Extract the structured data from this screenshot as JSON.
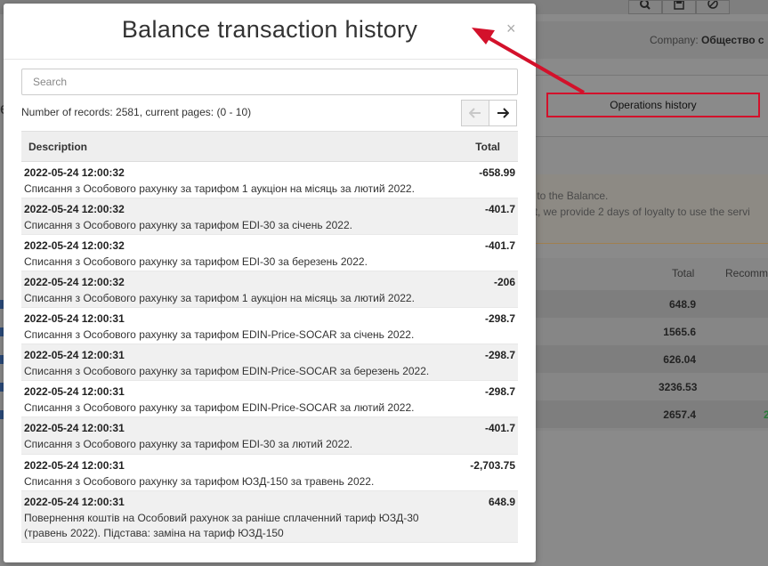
{
  "background": {
    "company_label": "Company:",
    "company_name": "Общество с",
    "operations_button": "Operations history",
    "notice_line1": "s to the Balance.",
    "notice_line2": "nt, we provide 2 days of loyalty to use the servi",
    "left_letter": "e",
    "table_header_total": "Total",
    "table_header_recommend": "Recomm",
    "table_values": [
      "648.9",
      "1565.6",
      "626.04",
      "3236.53",
      "2657.4"
    ],
    "trailing_digit": "2",
    "icons": [
      "search-icon",
      "save-icon",
      "block-icon"
    ]
  },
  "modal": {
    "title": "Balance transaction history",
    "close_label": "×",
    "search_placeholder": "Search",
    "records_text": "Number of records: 2581, current pages: (0 - 10)",
    "prev_label": "🡐",
    "next_label": "🡒",
    "columns": {
      "description": "Description",
      "total": "Total"
    },
    "rows": [
      {
        "date": "2022-05-24 12:00:32",
        "description": "Списання з Особового рахунку за тарифом 1 аукціон на місяць за лютий 2022.",
        "total": "-658.99"
      },
      {
        "date": "2022-05-24 12:00:32",
        "description": "Списання з Особового рахунку за тарифом EDI-30 за січень 2022.",
        "total": "-401.7"
      },
      {
        "date": "2022-05-24 12:00:32",
        "description": "Списання з Особового рахунку за тарифом EDI-30 за березень 2022.",
        "total": "-401.7"
      },
      {
        "date": "2022-05-24 12:00:32",
        "description": "Списання з Особового рахунку за тарифом 1 аукціон на місяць за лютий 2022.",
        "total": "-206"
      },
      {
        "date": "2022-05-24 12:00:31",
        "description": "Списання з Особового рахунку за тарифом EDIN-Price-SOCAR за січень 2022.",
        "total": "-298.7"
      },
      {
        "date": "2022-05-24 12:00:31",
        "description": "Списання з Особового рахунку за тарифом EDIN-Price-SOCAR за березень 2022.",
        "total": "-298.7"
      },
      {
        "date": "2022-05-24 12:00:31",
        "description": "Списання з Особового рахунку за тарифом EDIN-Price-SOCAR за лютий 2022.",
        "total": "-298.7"
      },
      {
        "date": "2022-05-24 12:00:31",
        "description": "Списання з Особового рахунку за тарифом EDI-30 за лютий 2022.",
        "total": "-401.7"
      },
      {
        "date": "2022-05-24 12:00:31",
        "description": "Списання з Особового рахунку за тарифом ЮЗД-150 за травень 2022.",
        "total": "-2,703.75"
      },
      {
        "date": "2022-05-24 12:00:31",
        "description": "Повернення коштів на Особовий рахунок за раніше сплаченний тариф ЮЗД-30 (травень 2022). Підстава: заміна на тариф ЮЗД-150",
        "total": "648.9"
      }
    ]
  },
  "colors": {
    "annotation_red": "#d3112b",
    "overlay": "#8a8a8a"
  }
}
